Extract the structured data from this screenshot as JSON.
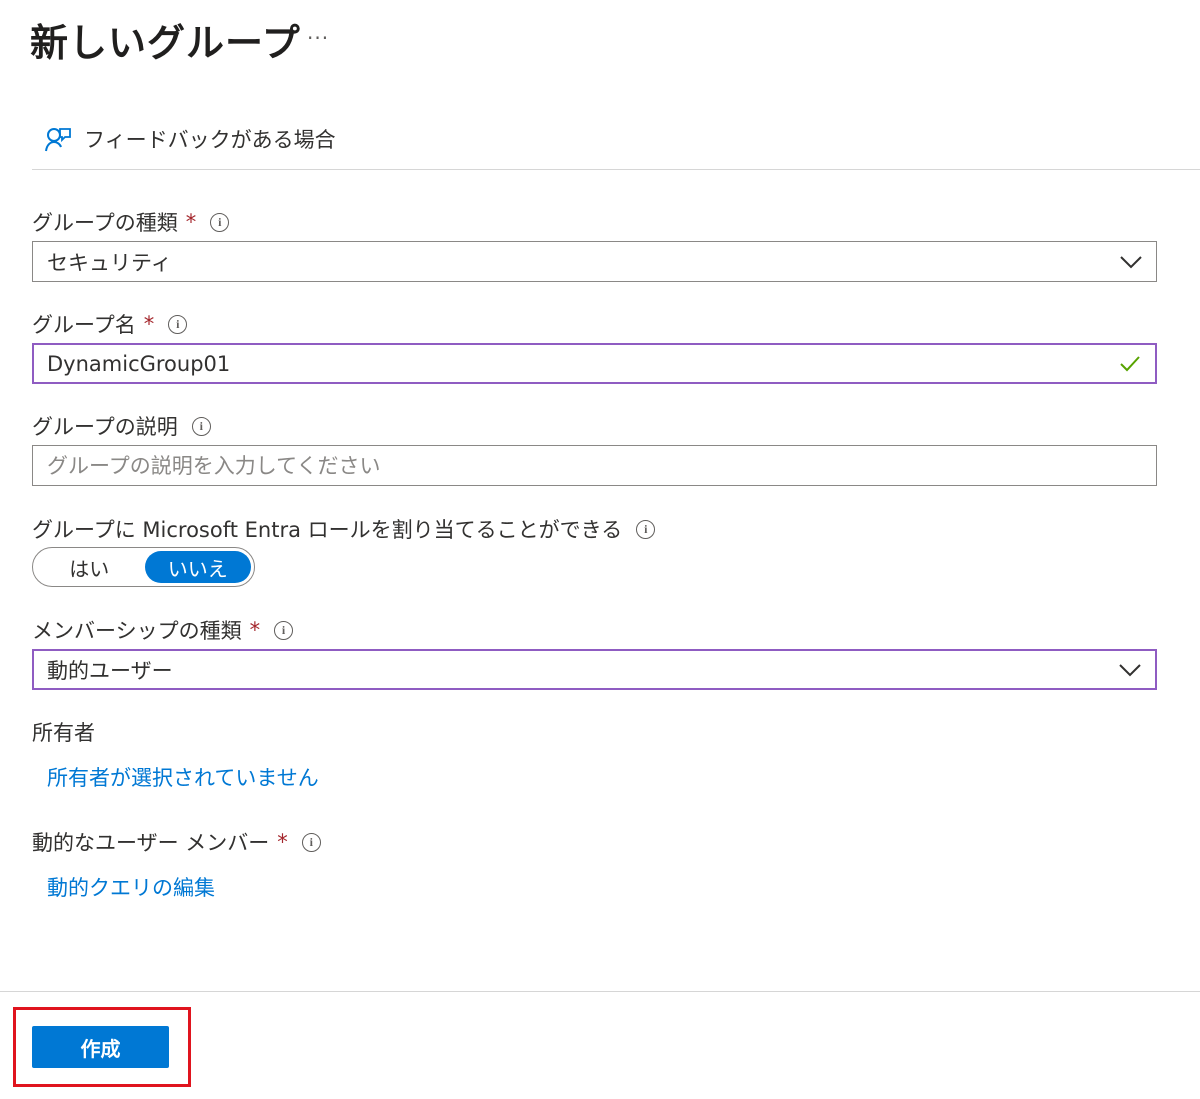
{
  "header": {
    "title": "新しいグループ",
    "more_label": "···"
  },
  "feedback": {
    "label": "フィードバックがある場合",
    "icon": "feedback-person-icon"
  },
  "form": {
    "group_type": {
      "label": "グループの種類",
      "required_mark": "*",
      "info_icon": "i",
      "value": "セキュリティ"
    },
    "group_name": {
      "label": "グループ名",
      "required_mark": "*",
      "info_icon": "i",
      "value": "DynamicGroup01"
    },
    "group_description": {
      "label": "グループの説明",
      "info_icon": "i",
      "placeholder": "グループの説明を入力してください"
    },
    "entra_role": {
      "label": "グループに Microsoft Entra ロールを割り当てることができる",
      "info_icon": "i",
      "option_yes": "はい",
      "option_no": "いいえ",
      "selected": "いいえ"
    },
    "membership_type": {
      "label": "メンバーシップの種類",
      "required_mark": "*",
      "info_icon": "i",
      "value": "動的ユーザー"
    },
    "owners": {
      "label": "所有者",
      "link": "所有者が選択されていません"
    },
    "dynamic_members": {
      "label": "動的なユーザー メンバー",
      "required_mark": "*",
      "info_icon": "i",
      "link": "動的クエリの編集"
    }
  },
  "footer": {
    "create_label": "作成"
  },
  "colors": {
    "accent": "#0078d4",
    "focus_border": "#8f5cc2",
    "required": "#a4262c",
    "valid_check": "#57a300",
    "highlight": "#e0141e"
  }
}
